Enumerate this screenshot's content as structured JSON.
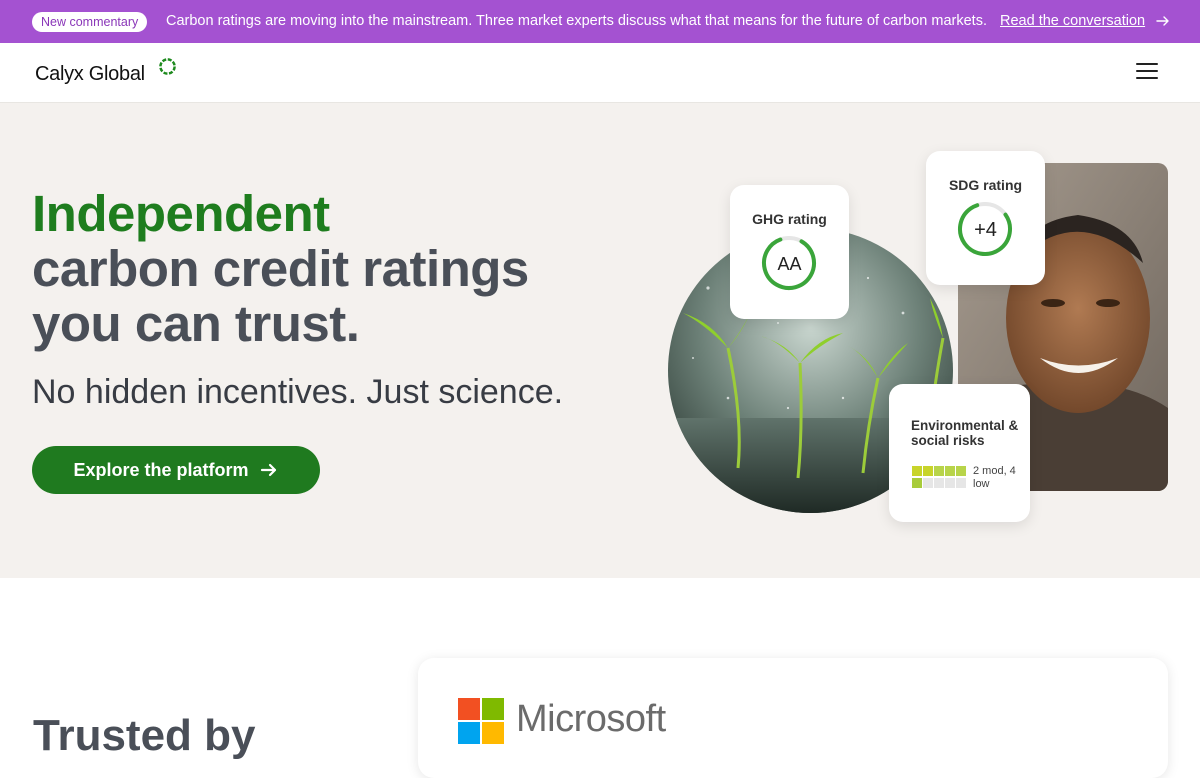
{
  "announcement": {
    "badge": "New commentary",
    "message": "Carbon ratings are moving into the mainstream. Three market experts discuss what that means for the future of carbon markets.",
    "link_label": "Read the conversation",
    "background_color": "#a452d1"
  },
  "nav": {
    "logo_text": "Calyx Global",
    "menu_icon": "hamburger-menu-icon"
  },
  "hero": {
    "headline_accent": "Independent",
    "headline_line2": "carbon credit ratings",
    "headline_line3": "you can trust.",
    "subheadline": "No hidden incentives. Just science.",
    "cta_label": "Explore the platform",
    "accent_color": "#1e7d1e",
    "background_color": "#f4f1ee"
  },
  "cards": {
    "ghg": {
      "title": "GHG rating",
      "value": "AA"
    },
    "sdg": {
      "title": "SDG rating",
      "value": "+4"
    },
    "env": {
      "title": "Environmental & social risks",
      "caption": "2 mod, 4 low"
    }
  },
  "trusted": {
    "heading": "Trusted by",
    "client_name": "Microsoft"
  }
}
